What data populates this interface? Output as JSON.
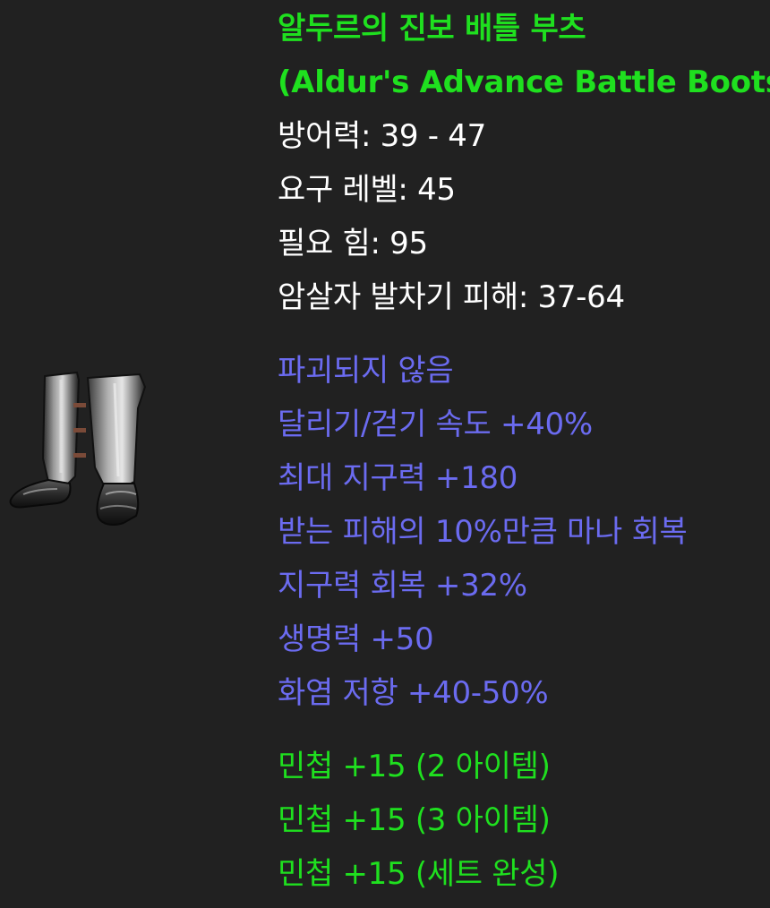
{
  "item": {
    "name_korean": "알두르의 진보 배틀 부츠",
    "name_english": "(Aldur's Advance Battle Boots)",
    "stats": [
      "방어력: 39 - 47",
      "요구 레벨: 45",
      "필요 힘: 95",
      "암살자 발차기 피해: 37-64"
    ],
    "magic_properties": [
      "파괴되지 않음",
      "달리기/걷기 속도 +40%",
      "최대 지구력 +180",
      "받는 피해의 10%만큼 마나 회복",
      "지구력 회복 +32%",
      "생명력 +50",
      "화염 저항 +40-50%"
    ],
    "set_bonuses": [
      "민첩 +15 (2 아이템)",
      "민첩 +15 (3 아이템)",
      "민첩 +15 (세트 완성)"
    ]
  },
  "colors": {
    "background": "#212121",
    "set_name": "#1fe01f",
    "base_stats": "#ffffff",
    "magic": "#6b6bf0",
    "set_bonus": "#1fe01f"
  },
  "icons": {
    "item": "battle-boots-icon"
  }
}
